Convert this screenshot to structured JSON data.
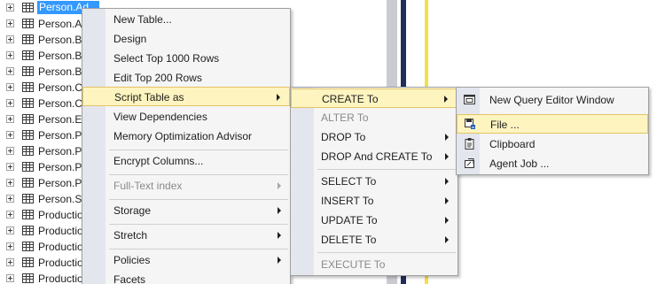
{
  "tree": {
    "items": [
      {
        "label": "Person.Ad...",
        "selected": true
      },
      {
        "label": "Person.A"
      },
      {
        "label": "Person.Bu"
      },
      {
        "label": "Person.Bu"
      },
      {
        "label": "Person.Bu"
      },
      {
        "label": "Person.C"
      },
      {
        "label": "Person.C"
      },
      {
        "label": "Person.Er"
      },
      {
        "label": "Person.Pa"
      },
      {
        "label": "Person.Pe"
      },
      {
        "label": "Person.Pe"
      },
      {
        "label": "Person.Pl"
      },
      {
        "label": "Person.St"
      },
      {
        "label": "Production"
      },
      {
        "label": "Production"
      },
      {
        "label": "Production"
      },
      {
        "label": "Production"
      },
      {
        "label": "Production"
      }
    ]
  },
  "context_menu": {
    "items": [
      {
        "label": "New Table..."
      },
      {
        "label": "Design"
      },
      {
        "label": "Select Top 1000 Rows"
      },
      {
        "label": "Edit Top 200 Rows"
      },
      {
        "label": "Script Table as",
        "submenu": true,
        "highlighted": true
      },
      {
        "label": "View Dependencies"
      },
      {
        "label": "Memory Optimization Advisor"
      },
      {
        "label": "Encrypt Columns..."
      },
      {
        "label": "Full-Text index",
        "submenu": true,
        "disabled": true
      },
      {
        "label": "Storage",
        "submenu": true
      },
      {
        "label": "Stretch",
        "submenu": true
      },
      {
        "label": "Policies",
        "submenu": true
      },
      {
        "label": "Facets"
      }
    ]
  },
  "script_menu": {
    "items": [
      {
        "label": "CREATE To",
        "submenu": true,
        "highlighted": true
      },
      {
        "label": "ALTER To",
        "disabled": true
      },
      {
        "label": "DROP To",
        "submenu": true
      },
      {
        "label": "DROP And CREATE To",
        "submenu": true
      },
      {
        "label": "SELECT To",
        "submenu": true
      },
      {
        "label": "INSERT To",
        "submenu": true
      },
      {
        "label": "UPDATE To",
        "submenu": true
      },
      {
        "label": "DELETE To",
        "submenu": true
      },
      {
        "label": "EXECUTE To",
        "disabled": true
      }
    ]
  },
  "create_menu": {
    "items": [
      {
        "label": "New Query Editor Window",
        "icon": "query-window-icon"
      },
      {
        "label": "File ...",
        "icon": "save-file-icon",
        "highlighted": true
      },
      {
        "label": "Clipboard",
        "icon": "clipboard-icon"
      },
      {
        "label": "Agent Job ...",
        "icon": "agent-job-icon"
      }
    ]
  },
  "colors": {
    "selection": "#3399ff",
    "menu_highlight": "#fdf4bf",
    "menu_highlight_border": "#e5c365",
    "menu_gutter": "#e4e6ee"
  }
}
